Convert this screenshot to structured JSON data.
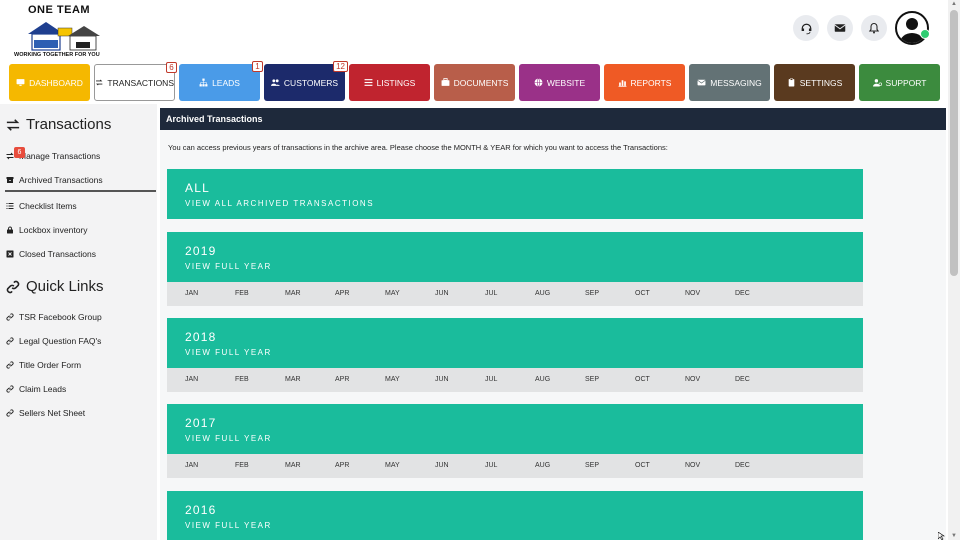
{
  "logo": {
    "title": "ONE TEAM",
    "tagline": "WORKING TOGETHER FOR YOU"
  },
  "header_icons": [
    "headset-icon",
    "mail-icon",
    "bell-icon",
    "user-avatar-icon"
  ],
  "nav": [
    {
      "label": "DASHBOARD",
      "icon": "monitor-icon",
      "color": "#f5b800",
      "badge": ""
    },
    {
      "label": "TRANSACTIONS",
      "icon": "exchange-icon",
      "color": "#ffffff",
      "badge": "6",
      "active": true
    },
    {
      "label": "LEADS",
      "icon": "sitemap-icon",
      "color": "#4a9be8",
      "badge": "1"
    },
    {
      "label": "CUSTOMERS",
      "icon": "users-icon",
      "color": "#1c2a6b",
      "badge": "12"
    },
    {
      "label": "LISTINGS",
      "icon": "list-icon",
      "color": "#c0242f",
      "badge": ""
    },
    {
      "label": "DOCUMENTS",
      "icon": "briefcase-icon",
      "color": "#b85e4a",
      "badge": ""
    },
    {
      "label": "WEBSITE",
      "icon": "globe-icon",
      "color": "#9a3188",
      "badge": ""
    },
    {
      "label": "REPORTS",
      "icon": "chart-icon",
      "color": "#ef5a25",
      "badge": ""
    },
    {
      "label": "MESSAGING",
      "icon": "envelope-icon",
      "color": "#637275",
      "badge": ""
    },
    {
      "label": "SETTINGS",
      "icon": "clipboard-icon",
      "color": "#5a3a1f",
      "badge": ""
    },
    {
      "label": "SUPPORT",
      "icon": "user-gear-icon",
      "color": "#3c8b3e",
      "badge": ""
    }
  ],
  "sidebar": {
    "heading": "Transactions",
    "badge": "6",
    "items": [
      {
        "label": "Manage Transactions",
        "icon": "exchange-icon"
      },
      {
        "label": "Archived Transactions",
        "icon": "archive-icon"
      },
      {
        "label": "Checklist Items",
        "icon": "list-icon"
      },
      {
        "label": "Lockbox inventory",
        "icon": "lock-icon"
      },
      {
        "label": "Closed Transactions",
        "icon": "x-box-icon"
      }
    ],
    "quick_links_heading": "Quick Links",
    "quick_links": [
      {
        "label": "TSR Facebook Group"
      },
      {
        "label": "Legal Question FAQ's"
      },
      {
        "label": "Title Order Form"
      },
      {
        "label": "Claim Leads"
      },
      {
        "label": "Sellers Net Sheet"
      }
    ]
  },
  "main": {
    "header": "Archived Transactions",
    "intro": "You can access previous years of transactions in the archive area. Please choose the MONTH & YEAR for which you want to access the Transactions:",
    "all_card": {
      "title": "ALL",
      "subtitle": "VIEW ALL ARCHIVED TRANSACTIONS"
    },
    "months": [
      "JAN",
      "FEB",
      "MAR",
      "APR",
      "MAY",
      "JUN",
      "JUL",
      "AUG",
      "SEP",
      "OCT",
      "NOV",
      "DEC"
    ],
    "years": [
      {
        "year": "2019",
        "subtitle": "VIEW FULL YEAR"
      },
      {
        "year": "2018",
        "subtitle": "VIEW FULL YEAR"
      },
      {
        "year": "2017",
        "subtitle": "VIEW FULL YEAR"
      },
      {
        "year": "2016",
        "subtitle": "VIEW FULL YEAR"
      }
    ]
  }
}
